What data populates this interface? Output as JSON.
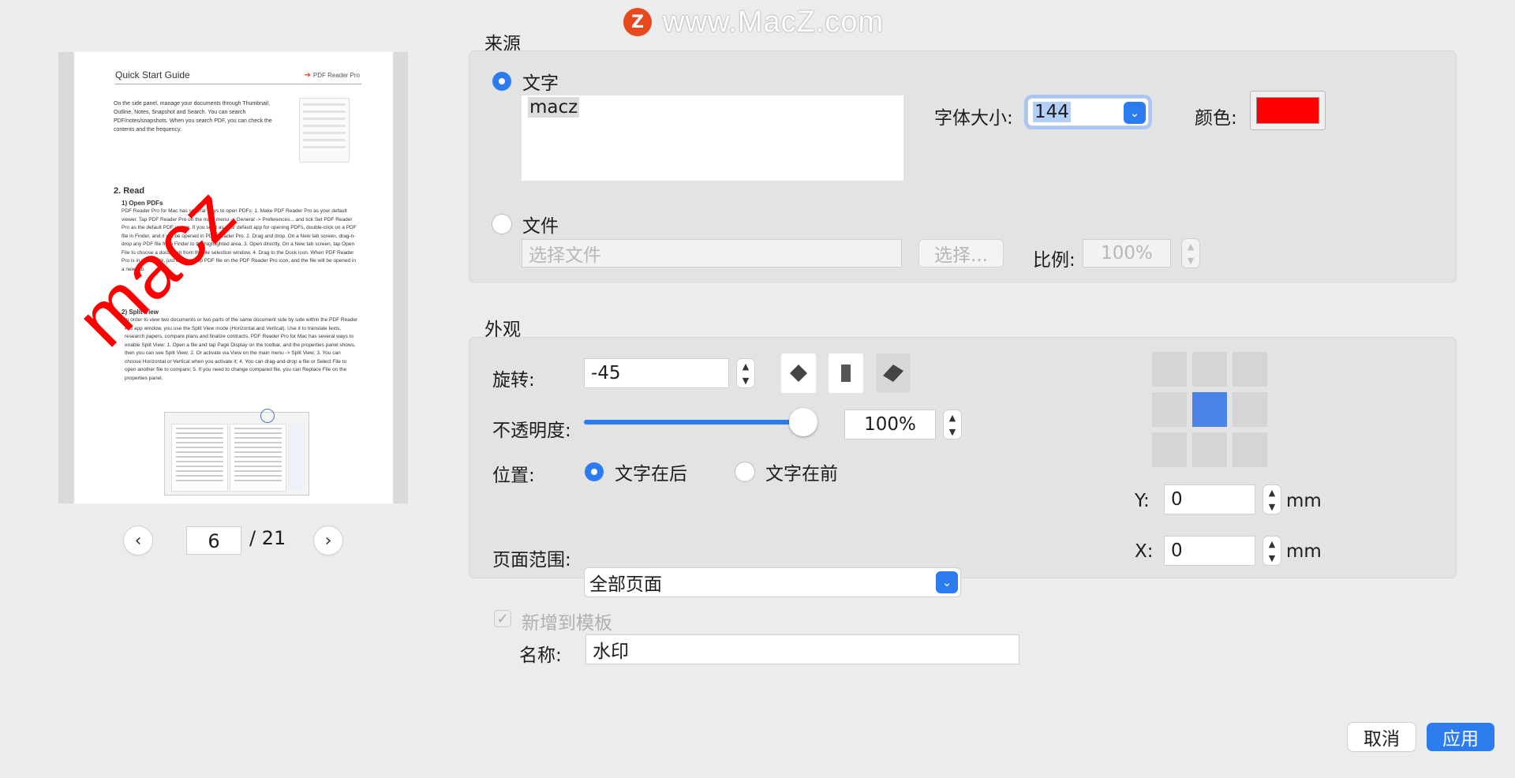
{
  "site_watermark": {
    "logo": "Z",
    "text": "www.MacZ.com"
  },
  "preview": {
    "doc_title": "Quick Start Guide",
    "doc_brand": "PDF Reader Pro",
    "intro": "On the side panel, manage your documents through Thumbnail, Outline, Notes, Snapshot and Search. You can search PDF/notes/snapshots. When you search PDF, you can check the contents and the frequency.",
    "h_read": "2. Read",
    "h_open": "1) Open PDFs",
    "open_body": "PDF Reader Pro for Mac has several ways to open PDFs: 1. Make PDF Reader Pro as your default viewer. Tap PDF Reader Pro on the main menu -> General -> Preferences... and tick Set PDF Reader Pro as the default PDF viewer. If you set it as your default app for opening PDFs, double-click on a PDF file in Finder, and it will be opened in PDF Reader Pro. 2. Drag and drop. On a New tab screen, drag-n-drop any PDF file from Finder to the highlighted area. 3. Open directly. On a New tab screen, tap Open File to choose a document from the file selection window. 4. Drag to the Dock icon. When PDF Reader Pro is in your dock, just drag-n-drop PDF file on the PDF Reader Pro icon, and the file will be opened in a new tab.",
    "h_split": "2) Split View",
    "split_body": "In order to view two documents or two parts of the same document side by side within the PDF Reader Pro app window, you use the Split View mode (Horizontal and Vertical). Use it to translate texts, research papers, compare plans and finalize contracts. PDF Reader Pro for Mac has several ways to enable Split View: 1. Open a file and tap Page Display on the toolbar, and the properties panel shows, then you can see Split View; 2. Or activate via View on the main menu -> Split View; 3. You can choose Horizontal or Vertical when you activate it; 4. You can drag-and-drop a file or Select File to open another file to compare; 5. If you need to change compared file, you can Replace File on the properties panel.",
    "watermark_text": "macz"
  },
  "pager": {
    "current": "6",
    "total": "/ 21"
  },
  "source": {
    "title": "来源",
    "text_label": "文字",
    "text_value": "macz",
    "font_size_label": "字体大小:",
    "font_size_value": "144",
    "color_label": "颜色:",
    "color_value": "#ff0000",
    "file_label": "文件",
    "file_placeholder": "选择文件",
    "choose_label": "选择...",
    "scale_label": "比例:",
    "scale_value": "100%"
  },
  "appearance": {
    "title": "外观",
    "rotation_label": "旋转:",
    "rotation_value": "-45",
    "opacity_label": "不透明度:",
    "opacity_value": "100%",
    "opacity_fraction": 1.0,
    "position_label": "位置:",
    "behind_label": "文字在后",
    "front_label": "文字在前",
    "page_range_label": "页面范围:",
    "page_range_value": "全部页面",
    "y_label": "Y:",
    "y_value": "0",
    "x_label": "X:",
    "x_value": "0",
    "unit": "mm"
  },
  "template": {
    "add_label": "新增到模板",
    "name_label": "名称:",
    "name_value": "水印"
  },
  "buttons": {
    "cancel": "取消",
    "apply": "应用"
  },
  "colors": {
    "accent": "#2c7cf0",
    "watermark": "#ff0000"
  }
}
